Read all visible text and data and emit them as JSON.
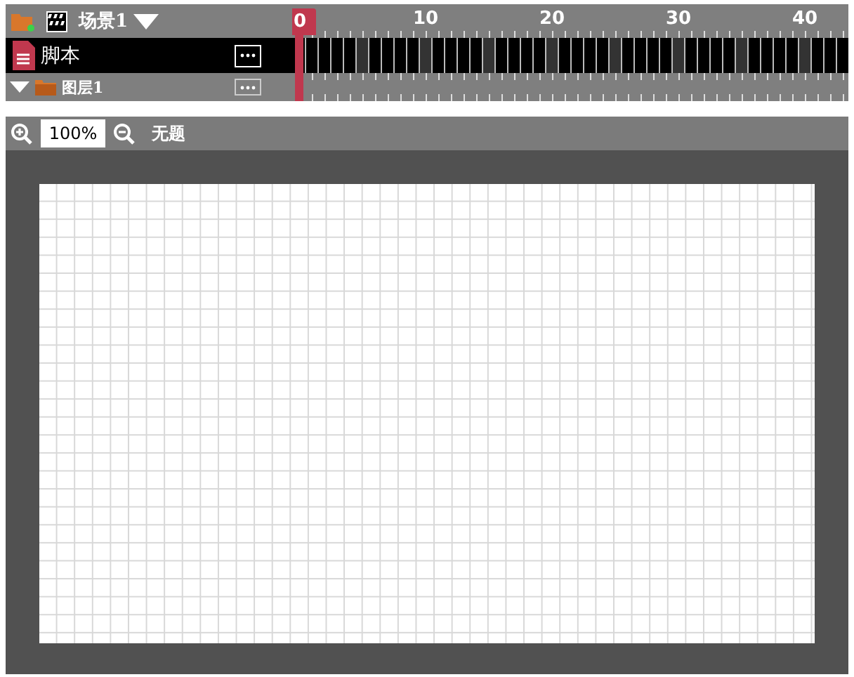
{
  "timeline": {
    "scene": {
      "label": "场景1"
    },
    "playhead": {
      "label": "0"
    },
    "ruler_labels": [
      "10",
      "20",
      "30",
      "40"
    ],
    "layers": [
      {
        "kind": "script",
        "name": "脚本",
        "selected": true
      },
      {
        "kind": "layer",
        "name": "图层1",
        "selected": false,
        "expanded": true
      }
    ]
  },
  "toolbar": {
    "zoom": "100%",
    "document_title": "无题"
  }
}
